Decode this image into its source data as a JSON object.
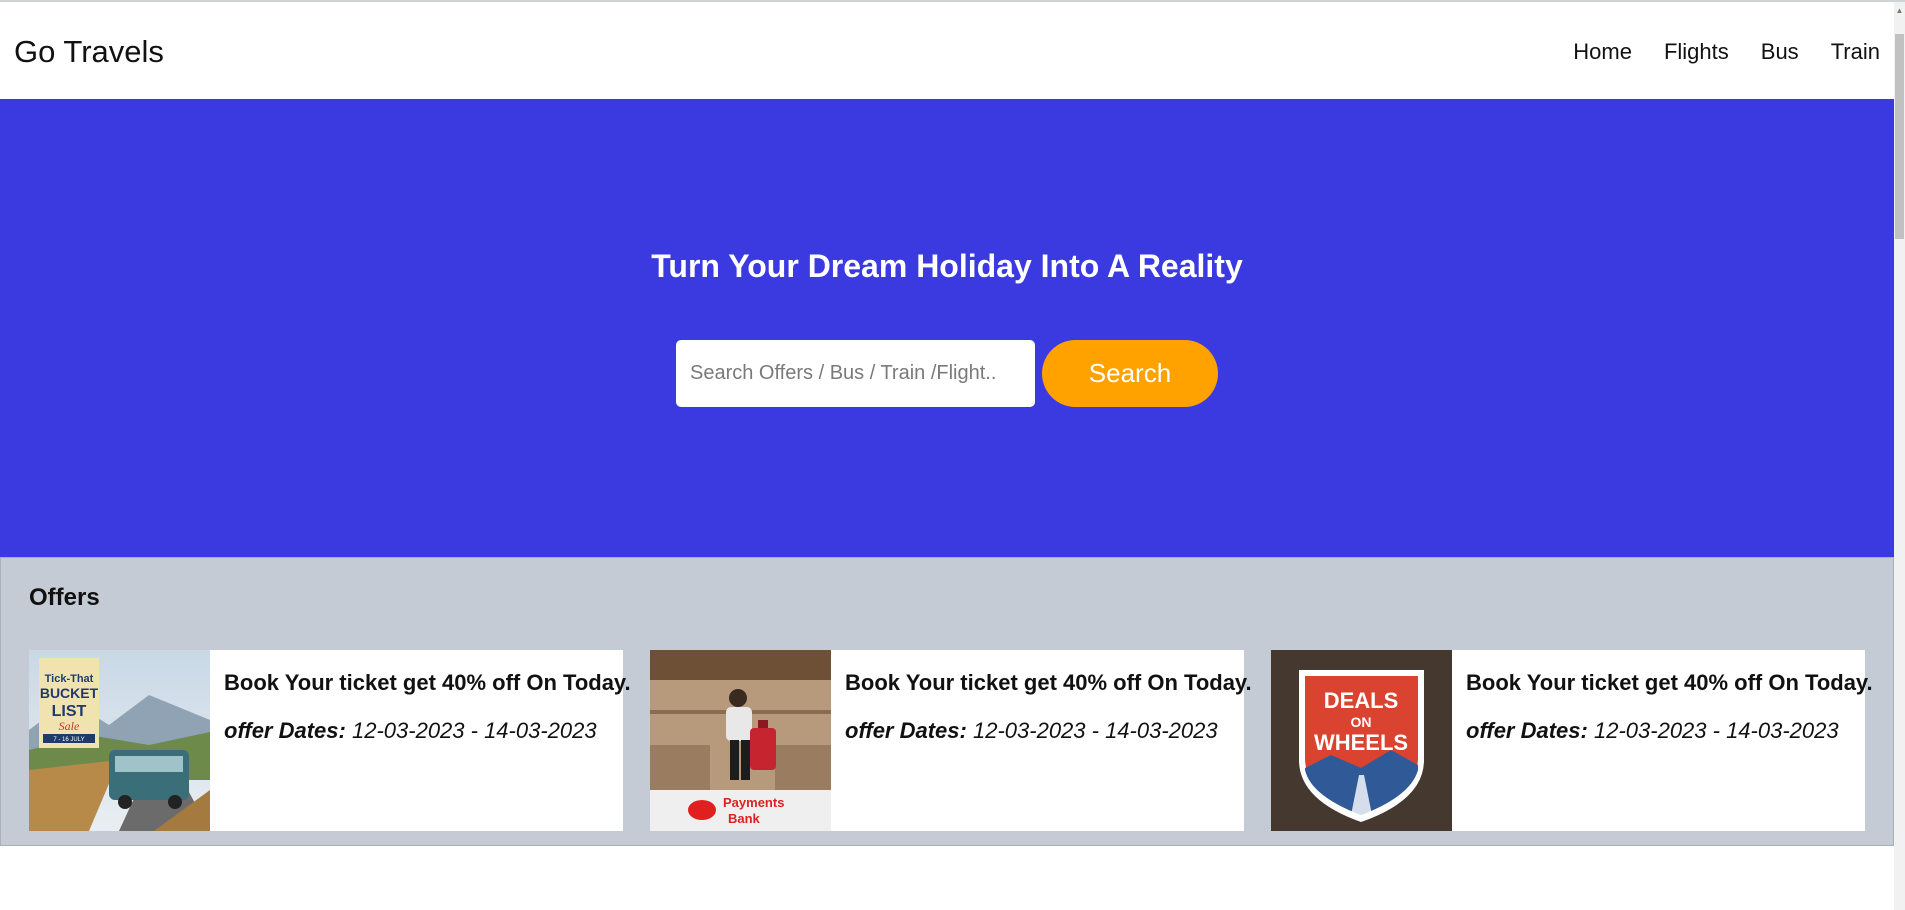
{
  "navbar": {
    "brand": "Go Travels",
    "links": [
      "Home",
      "Flights",
      "Bus",
      "Train"
    ]
  },
  "hero": {
    "title": "Turn Your Dream Holiday Into A Reality",
    "search_placeholder": "Search Offers / Bus / Train /Flight..",
    "search_button": "Search",
    "background_color": "#3b3ae0",
    "button_color": "#ffa200"
  },
  "offers": {
    "title": "Offers",
    "cards": [
      {
        "image": "bus-bucket-list-sale-image",
        "image_text": [
          "Tick-That",
          "BUCKET",
          "LIST",
          "Sale",
          "7 - 16 JULY"
        ],
        "headline": "Book Your ticket get 40% off On Today.",
        "dates_label": "offer Dates:",
        "dates_value": "12-03-2023 - 14-03-2023"
      },
      {
        "image": "traveler-payments-bank-image",
        "image_text": [
          "Payments",
          "Bank"
        ],
        "headline": "Book Your ticket get 40% off On Today.",
        "dates_label": "offer Dates:",
        "dates_value": "12-03-2023 - 14-03-2023"
      },
      {
        "image": "deals-on-wheels-badge-image",
        "image_text": [
          "DEALS",
          "ON",
          "WHEELS"
        ],
        "headline": "Book Your ticket get 40% off On Today.",
        "dates_label": "offer Dates:",
        "dates_value": "12-03-2023 - 14-03-2023"
      }
    ]
  }
}
